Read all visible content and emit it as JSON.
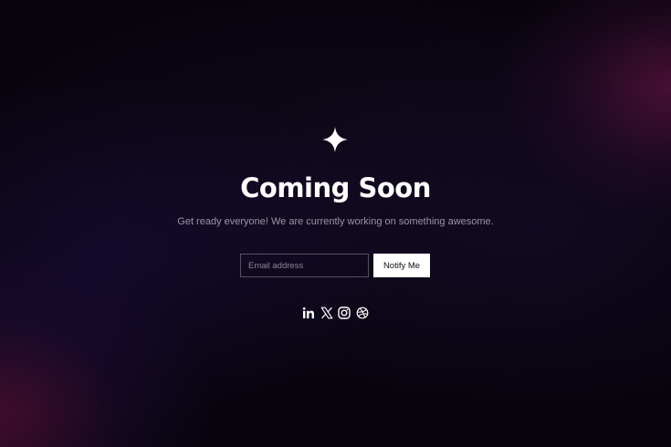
{
  "colors": {
    "background": "#07040c",
    "accent_glow": "#78184f",
    "text_primary": "#ffffff",
    "text_secondary": "#9a96a4",
    "input_border": "#55525e",
    "button_background": "#ffffff",
    "button_text": "#111111"
  },
  "hero": {
    "logo_icon": "four-point-star-icon",
    "title": "Coming Soon",
    "subtitle": "Get ready everyone! We are currently working on something awesome."
  },
  "signup": {
    "email_placeholder": "Email address",
    "email_value": "",
    "submit_label": "Notify Me"
  },
  "social": {
    "icons": [
      "linkedin-icon",
      "x-twitter-icon",
      "instagram-icon",
      "dribbble-icon"
    ]
  }
}
